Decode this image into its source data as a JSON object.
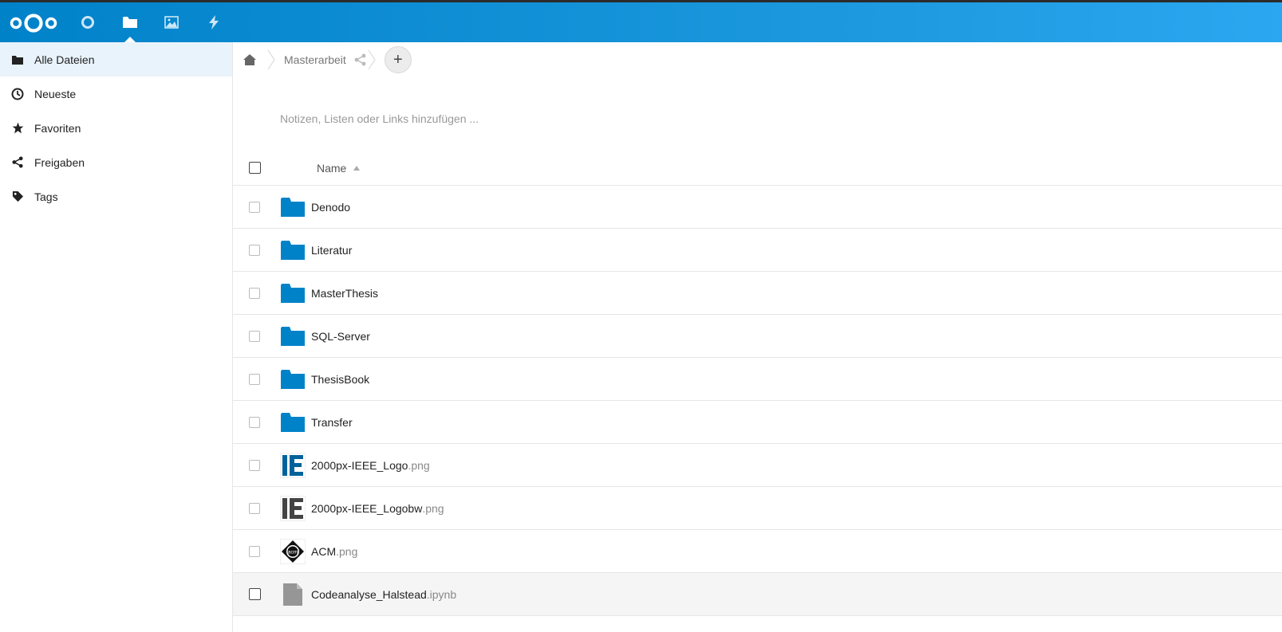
{
  "nav": {
    "apps": [
      {
        "name": "dashboard-icon"
      },
      {
        "name": "files-icon"
      },
      {
        "name": "photos-icon"
      },
      {
        "name": "activity-icon"
      }
    ]
  },
  "sidebar": {
    "items": [
      {
        "label": "Alle Dateien",
        "icon": "folder-icon"
      },
      {
        "label": "Neueste",
        "icon": "clock-icon"
      },
      {
        "label": "Favoriten",
        "icon": "star-icon"
      },
      {
        "label": "Freigaben",
        "icon": "share-icon"
      },
      {
        "label": "Tags",
        "icon": "tag-icon"
      }
    ]
  },
  "breadcrumb": {
    "current": "Masterarbeit",
    "add_label": "+"
  },
  "notes": {
    "placeholder": "Notizen, Listen oder Links hinzufügen ..."
  },
  "table": {
    "name_header": "Name",
    "rows": [
      {
        "name": "Denodo",
        "ext": "",
        "type": "folder"
      },
      {
        "name": "Literatur",
        "ext": "",
        "type": "folder"
      },
      {
        "name": "MasterThesis",
        "ext": "",
        "type": "folder"
      },
      {
        "name": "SQL-Server",
        "ext": "",
        "type": "folder"
      },
      {
        "name": "ThesisBook",
        "ext": "",
        "type": "folder"
      },
      {
        "name": "Transfer",
        "ext": "",
        "type": "folder"
      },
      {
        "name": "2000px-IEEE_Logo",
        "ext": ".png",
        "type": "ieee-color"
      },
      {
        "name": "2000px-IEEE_Logobw",
        "ext": ".png",
        "type": "ieee-bw"
      },
      {
        "name": "ACM",
        "ext": ".png",
        "type": "acm",
        "logo_text": "acm"
      },
      {
        "name": "Codeanalyse_Halstead",
        "ext": ".ipynb",
        "type": "file"
      }
    ]
  },
  "colors": {
    "header": "#0082c9",
    "folder": "#0082c9"
  }
}
